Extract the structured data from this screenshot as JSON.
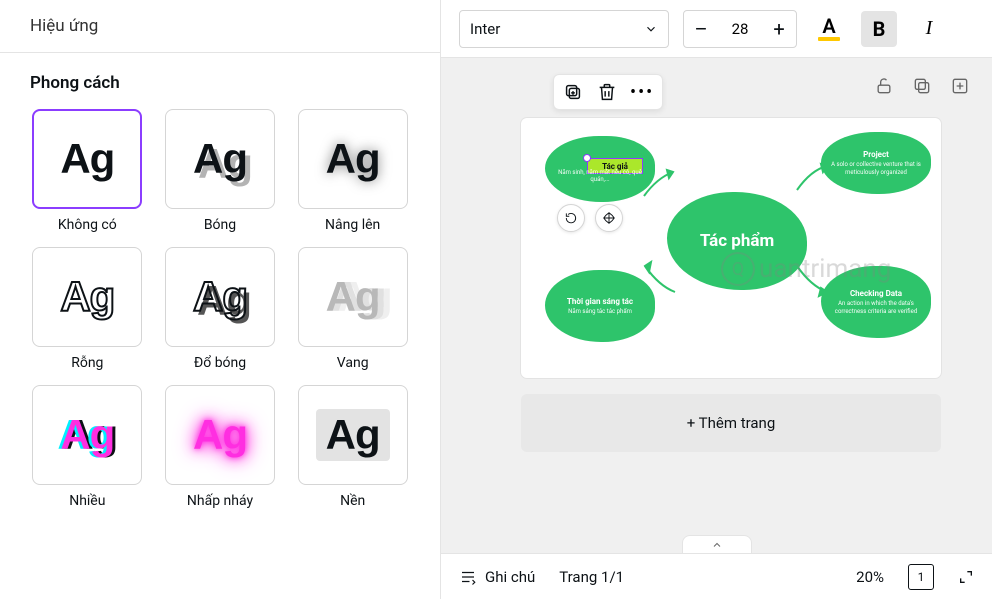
{
  "sidebar": {
    "header": "Hiệu ứng",
    "sectionTitle": "Phong cách",
    "styles": [
      {
        "label": "Không có"
      },
      {
        "label": "Bóng"
      },
      {
        "label": "Nâng lên"
      },
      {
        "label": "Rỗng"
      },
      {
        "label": "Đổ bóng"
      },
      {
        "label": "Vang"
      },
      {
        "label": "Nhiều"
      },
      {
        "label": "Nhấp nháy"
      },
      {
        "label": "Nền"
      }
    ],
    "sample": "Ag"
  },
  "toolbar": {
    "fontName": "Inter",
    "fontSize": "28",
    "minus": "–",
    "plus": "+",
    "colorLetter": "A",
    "bold": "B",
    "italic": "I"
  },
  "canvas": {
    "center": "Tác phẩm",
    "tl": {
      "h": "Tác giả",
      "d": "Năm sinh, năm mất nếu có, quê quán,..."
    },
    "tr": {
      "h": "Project",
      "d": "A solo or collective venture that is meticulously organized"
    },
    "bl": {
      "h": "Thời gian sáng tác",
      "d": "Năm sáng tác tác phẩm"
    },
    "br": {
      "h": "Checking Data",
      "d": "An action in which the data's correctness criteria are verified"
    },
    "addPage": "+ Thêm trang"
  },
  "footer": {
    "notes": "Ghi chú",
    "page": "Trang 1/1",
    "zoom": "20%",
    "pages": "1"
  },
  "watermark": "uantrimang"
}
